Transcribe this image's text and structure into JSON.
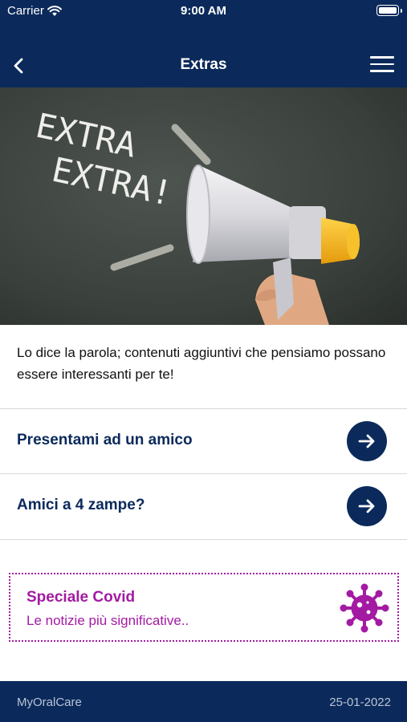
{
  "status_bar": {
    "carrier": "Carrier",
    "time": "9:00 AM"
  },
  "nav": {
    "title": "Extras"
  },
  "hero": {
    "chalk_line1": "EXTRA",
    "chalk_line2": "EXTRA!"
  },
  "intro_text": "Lo dice la parola; contenuti aggiuntivi che pensiamo possano essere interessanti per te!",
  "items": [
    {
      "label": "Presentami ad un amico"
    },
    {
      "label": "Amici a 4 zampe?"
    }
  ],
  "covid": {
    "title": "Speciale Covid",
    "subtitle": "Le notizie più significative.."
  },
  "footer": {
    "app_name": "MyOralCare",
    "date": "25-01-2022"
  },
  "colors": {
    "primary": "#0b2a5b",
    "accent": "#a31aa3",
    "megaphone_yellow": "#f4b41a"
  }
}
